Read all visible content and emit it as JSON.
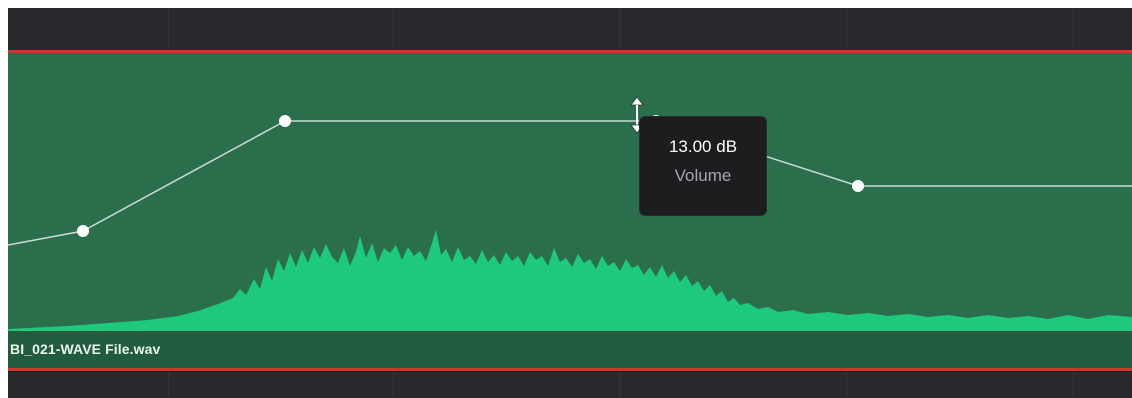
{
  "clip": {
    "name": "BI_021-WAVE File.wav"
  },
  "tooltip": {
    "value": "13.00 dB",
    "label": "Volume"
  },
  "icons": {
    "cursor": "vertical-resize-cursor-icon",
    "keyframe": "keyframe-dot-icon"
  },
  "colors": {
    "clip_bg": "#2b6e4c",
    "waveform": "#1ec87d",
    "playhead_red": "#d0362e",
    "tooltip_bg": "#1b1d1f"
  }
}
